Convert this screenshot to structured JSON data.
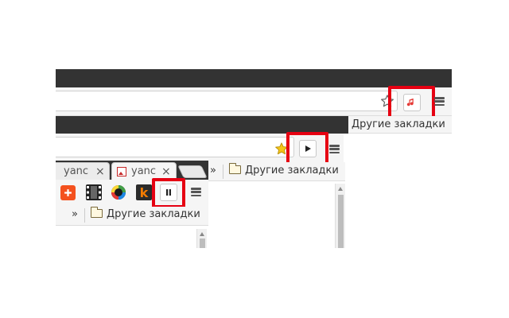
{
  "colors": {
    "highlight": "#e60012",
    "dark_bar": "#333333",
    "toolbar_bg": "#f5f5f5"
  },
  "icons": {
    "bookmark_star": "star-outline-icon",
    "bookmark_star_filled": "star-filled-icon",
    "music_extension": "music-note-icon",
    "play_extension": "play-icon",
    "pause_extension": "pause-icon",
    "menu": "hamburger-menu-icon",
    "folder": "folder-icon",
    "overflow": "double-chevron-icon"
  },
  "layer_top": {
    "bookmarks_label": "Другие закладки"
  },
  "layer_middle": {
    "bookmarks_label": "Другие закладки",
    "overflow": "»"
  },
  "layer_bottom": {
    "tabs": [
      {
        "label": "yanc"
      },
      {
        "label": "yanc"
      }
    ],
    "tab_close": "×",
    "bookmarks_label": "Другие закладки",
    "overflow": "»",
    "ext_k_label": "k"
  }
}
